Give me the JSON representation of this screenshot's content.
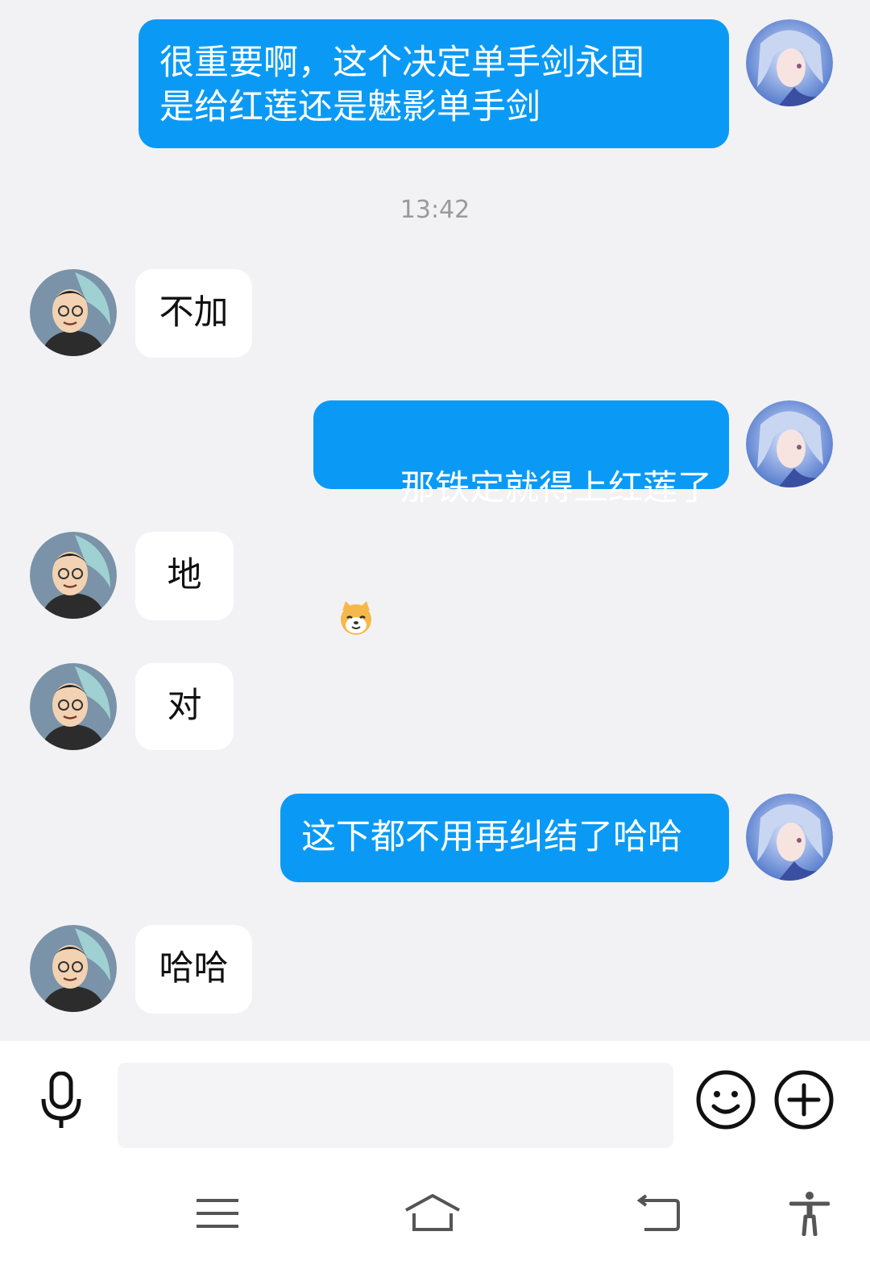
{
  "messages": [
    {
      "side": "mine",
      "text": "很重要啊，这个决定单手剑永固\n是给红莲还是魅影单手剑"
    },
    {
      "side": "theirs",
      "text": "不加"
    },
    {
      "side": "mine",
      "text": "那铁定就得上红莲了",
      "emoji": "dog-emoji"
    },
    {
      "side": "theirs",
      "text": "地"
    },
    {
      "side": "theirs",
      "text": "对"
    },
    {
      "side": "mine",
      "text": "这下都不用再纠结了哈哈"
    },
    {
      "side": "theirs",
      "text": "哈哈"
    }
  ],
  "timestamp": "13:42",
  "input": {
    "placeholder": ""
  },
  "icons": {
    "voice": "microphone-icon",
    "emoji": "smiley-icon",
    "more": "plus-circle-icon",
    "nav": [
      "menu-icon",
      "home-icon",
      "back-icon",
      "accessibility-icon"
    ]
  },
  "colors": {
    "my_bubble": "#0a9af5",
    "their_bubble": "#ffffff",
    "background": "#f2f2f4"
  }
}
